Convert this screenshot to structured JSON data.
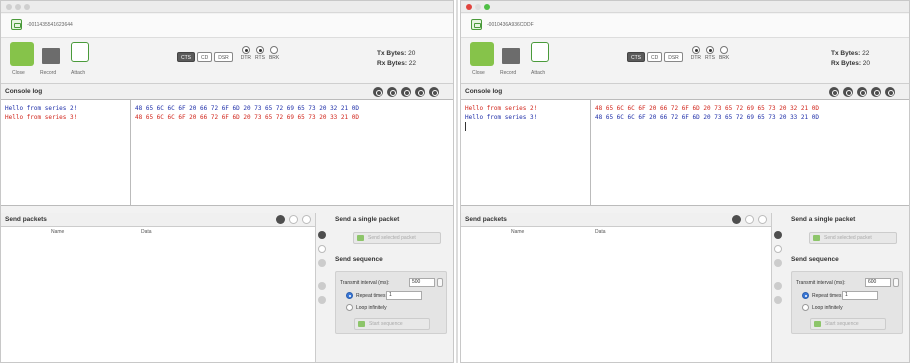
{
  "windows": [
    {
      "device": "-0011435541623644",
      "toolbar": {
        "close": "Close",
        "record": "Record",
        "attach": "Attach"
      },
      "pins": {
        "cts": "CTS",
        "cd": "CD",
        "dsr": "DSR",
        "dtr": "DTR",
        "rts": "RTS",
        "brk": "BRK"
      },
      "bytes": {
        "tx_label": "Tx Bytes:",
        "tx_value": "20",
        "rx_label": "Rx Bytes:",
        "rx_value": "22"
      },
      "console": {
        "title": "Console log",
        "ascii": [
          "Hello from series 2!",
          "Hello from series 3!"
        ],
        "hex": [
          "48 65 6C 6C 6F 20 66 72 6F 6D 20 73 65 72 69 65 73 20 32 21 0D",
          "48 65 6C 6C 6F 20 66 72 6F 6D 20 73 65 72 69 65 73 20 33 21 0D"
        ],
        "colors": [
          "blue",
          "red"
        ]
      },
      "send": {
        "title": "Send packets",
        "col_name": "Name",
        "col_data": "Data",
        "single_title": "Send a single packet",
        "send_selected": "Send selected packet",
        "seq_title": "Send sequence",
        "interval_label": "Transmit interval (ms):",
        "interval_value": "500",
        "repeat_label": "Repeat times",
        "repeat_value": "1",
        "loop_label": "Loop infinitely",
        "start_seq": "Start sequence"
      }
    },
    {
      "device": "-0010436A936CDDF",
      "toolbar": {
        "close": "Close",
        "record": "Record",
        "attach": "Attach"
      },
      "pins": {
        "cts": "CTS",
        "cd": "CD",
        "dsr": "DSR",
        "dtr": "DTR",
        "rts": "RTS",
        "brk": "BRK"
      },
      "bytes": {
        "tx_label": "Tx Bytes:",
        "tx_value": "22",
        "rx_label": "Rx Bytes:",
        "rx_value": "20"
      },
      "console": {
        "title": "Console log",
        "ascii": [
          "Hello from series 2!",
          "Hello from series 3!"
        ],
        "hex": [
          "48 65 6C 6C 6F 20 66 72 6F 6D 20 73 65 72 69 65 73 20 32 21 0D",
          "48 65 6C 6C 6F 20 66 72 6F 6D 20 73 65 72 69 65 73 20 33 21 0D"
        ],
        "colors": [
          "red",
          "blue"
        ]
      },
      "send": {
        "title": "Send packets",
        "col_name": "Name",
        "col_data": "Data",
        "single_title": "Send a single packet",
        "send_selected": "Send selected packet",
        "seq_title": "Send sequence",
        "interval_label": "Transmit interval (ms):",
        "interval_value": "600",
        "repeat_label": "Repeat times",
        "repeat_value": "1",
        "loop_label": "Loop infinitely",
        "start_seq": "Start sequence"
      }
    }
  ]
}
